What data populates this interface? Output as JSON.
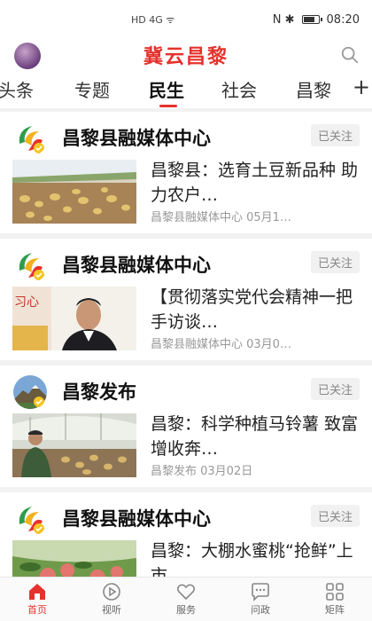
{
  "statusbar": {
    "left_text": "HD 4G ᯤ",
    "right_icons": "N ✱",
    "time": "08:20"
  },
  "header": {
    "title": "冀云昌黎"
  },
  "tabs": {
    "items": [
      "头条",
      "专题",
      "民生",
      "社会",
      "昌黎"
    ],
    "active": "民生",
    "more_label": "+"
  },
  "feed": [
    {
      "source": "昌黎县融媒体中心",
      "follow_label": "已关注",
      "headline": "昌黎县：选育土豆新品种 助力农户…",
      "meta": "昌黎县融媒体中心 05月1…",
      "logo_icon": "swirl-logo-icon"
    },
    {
      "source": "昌黎县融媒体中心",
      "follow_label": "已关注",
      "headline": "【贯彻落实党代会精神一把手访谈…",
      "meta": "昌黎县融媒体中心 03月0…",
      "logo_icon": "swirl-logo-icon"
    },
    {
      "source": "昌黎发布",
      "follow_label": "已关注",
      "headline": "昌黎：科学种植马铃薯 致富增收奔…",
      "meta": "昌黎发布 03月02日",
      "logo_icon": "mountain-logo-icon"
    },
    {
      "source": "昌黎县融媒体中心",
      "follow_label": "已关注",
      "headline": "昌黎：大棚水蜜桃“抢鲜”上市",
      "meta": "",
      "logo_icon": "swirl-logo-icon"
    }
  ],
  "bottomnav": {
    "items": [
      {
        "label": "首页",
        "icon": "home-icon"
      },
      {
        "label": "视听",
        "icon": "play-icon"
      },
      {
        "label": "服务",
        "icon": "heart-icon"
      },
      {
        "label": "问政",
        "icon": "chat-icon"
      },
      {
        "label": "矩阵",
        "icon": "grid-icon"
      }
    ],
    "active": "首页"
  },
  "colors": {
    "brand": "#e5322d",
    "follow_bg": "#f1f1f1",
    "meta_text": "#999999"
  }
}
